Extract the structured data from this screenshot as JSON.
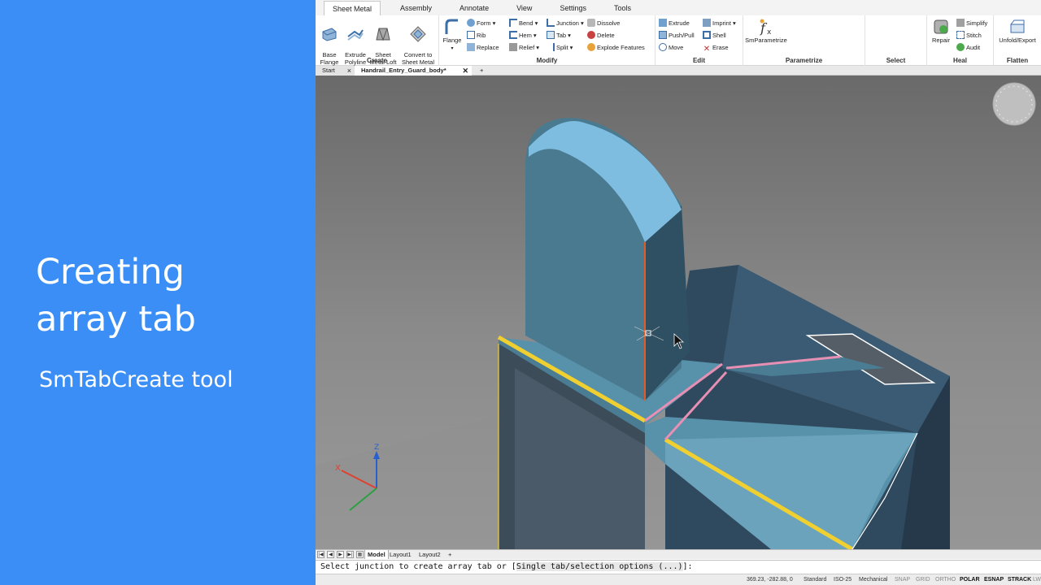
{
  "panel": {
    "title": "Creating\narray tab",
    "subtitle": "SmTabCreate tool",
    "background": "#3a8ef6"
  },
  "ribbon": {
    "tabs": [
      "Sheet Metal",
      "Assembly",
      "Annotate",
      "View",
      "Settings",
      "Tools"
    ],
    "active_tab": "Sheet Metal",
    "groups": {
      "create": {
        "label": "Create",
        "buttons": [
          "Base\nFlange",
          "Extrude\nPolyline",
          "Sheet\nMetal Loft",
          "Convert to\nSheet Metal"
        ]
      },
      "modify": {
        "label": "Modify",
        "flange": "Flange",
        "col1": [
          "Form",
          "Rib",
          "Replace"
        ],
        "col2": [
          "Bend",
          "Hem",
          "Relief"
        ],
        "col3": [
          "Junction",
          "Tab",
          "Split"
        ],
        "col4": [
          "Dissolve",
          "Delete",
          "Explode Features"
        ]
      },
      "edit": {
        "label": "Edit",
        "col1": [
          "Extrude",
          "Push/Pull",
          "Move"
        ],
        "col2": [
          "Imprint",
          "Shell",
          "Erase"
        ]
      },
      "parametrize": {
        "label": "Parametrize",
        "button": "SmParametrize"
      },
      "select": {
        "label": "Select"
      },
      "heal": {
        "label": "Heal",
        "repair": "Repair",
        "items": [
          "Simplify",
          "Stitch",
          "Audit"
        ]
      },
      "flatten": {
        "label": "Flatten",
        "button": "Unfold/Export"
      }
    }
  },
  "doc_tabs": {
    "start": "Start",
    "current": "Handrail_Entry_Guard_body*",
    "add": "+"
  },
  "layout_tabs": [
    "Model",
    "Layout1",
    "Layout2",
    "+"
  ],
  "command_line": {
    "prefix": "Select junction to create array tab or [",
    "option": "Single tab/selection options (...)",
    "suffix": "]:"
  },
  "status_bar": {
    "coords": "369.23, -282.88, 0",
    "style": "Standard",
    "dimstyle": "ISO-25",
    "workspace": "Mechanical",
    "toggles": [
      "SNAP",
      "GRID",
      "ORTHO",
      "POLAR",
      "ESNAP",
      "STRACK",
      "LWT"
    ]
  },
  "colors": {
    "accent": "#3a8ef6",
    "selection_edge": "#f0d030",
    "highlight_edge": "#e88fb4",
    "part_face": "#5b8fa5"
  }
}
